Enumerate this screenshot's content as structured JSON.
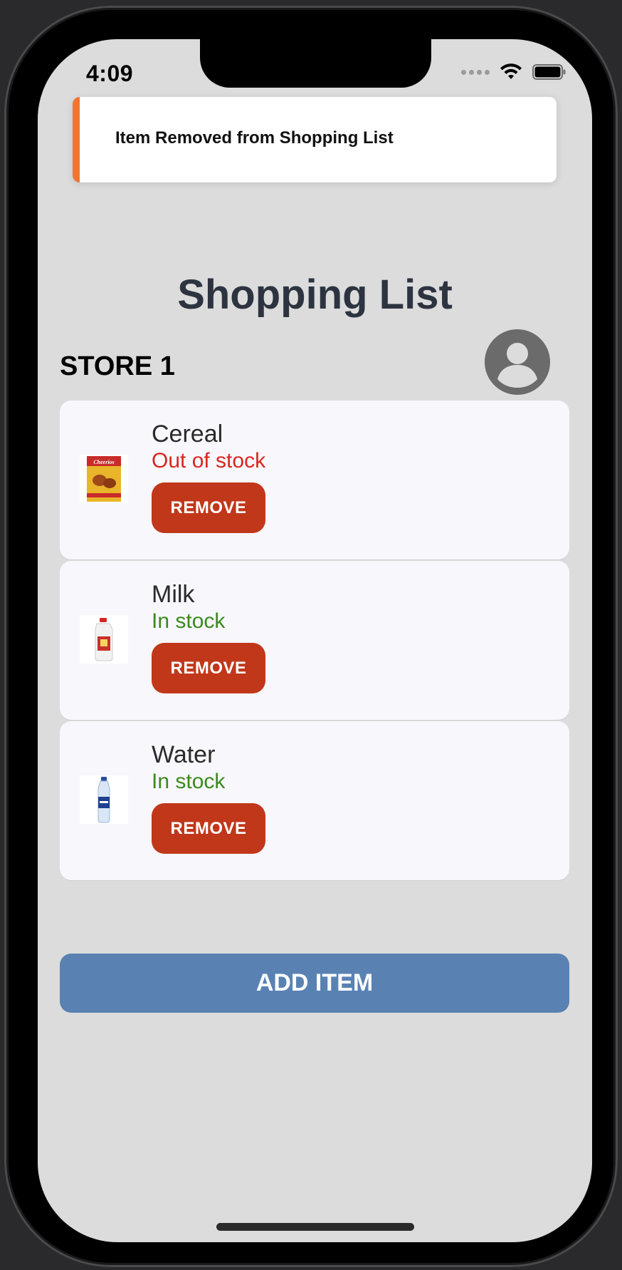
{
  "status_bar": {
    "time": "4:09"
  },
  "toast": {
    "message": "Item Removed from Shopping List",
    "accent_color": "#f07530"
  },
  "page": {
    "title": "Shopping List",
    "store_label": "STORE 1"
  },
  "items": [
    {
      "name": "Cereal",
      "status": "Out of stock",
      "status_color": "#d9261f",
      "remove_label": "REMOVE",
      "thumbnail": "cereal-box-icon"
    },
    {
      "name": "Milk",
      "status": "In stock",
      "status_color": "#3a8a1e",
      "remove_label": "REMOVE",
      "thumbnail": "milk-jug-icon"
    },
    {
      "name": "Water",
      "status": "In stock",
      "status_color": "#3a8a1e",
      "remove_label": "REMOVE",
      "thumbnail": "water-bottle-icon"
    }
  ],
  "add_button": {
    "label": "ADD ITEM",
    "color": "#5982b3"
  },
  "colors": {
    "remove_button": "#c1371a",
    "background": "#dcdcdd",
    "card": "#f8f7fc"
  }
}
